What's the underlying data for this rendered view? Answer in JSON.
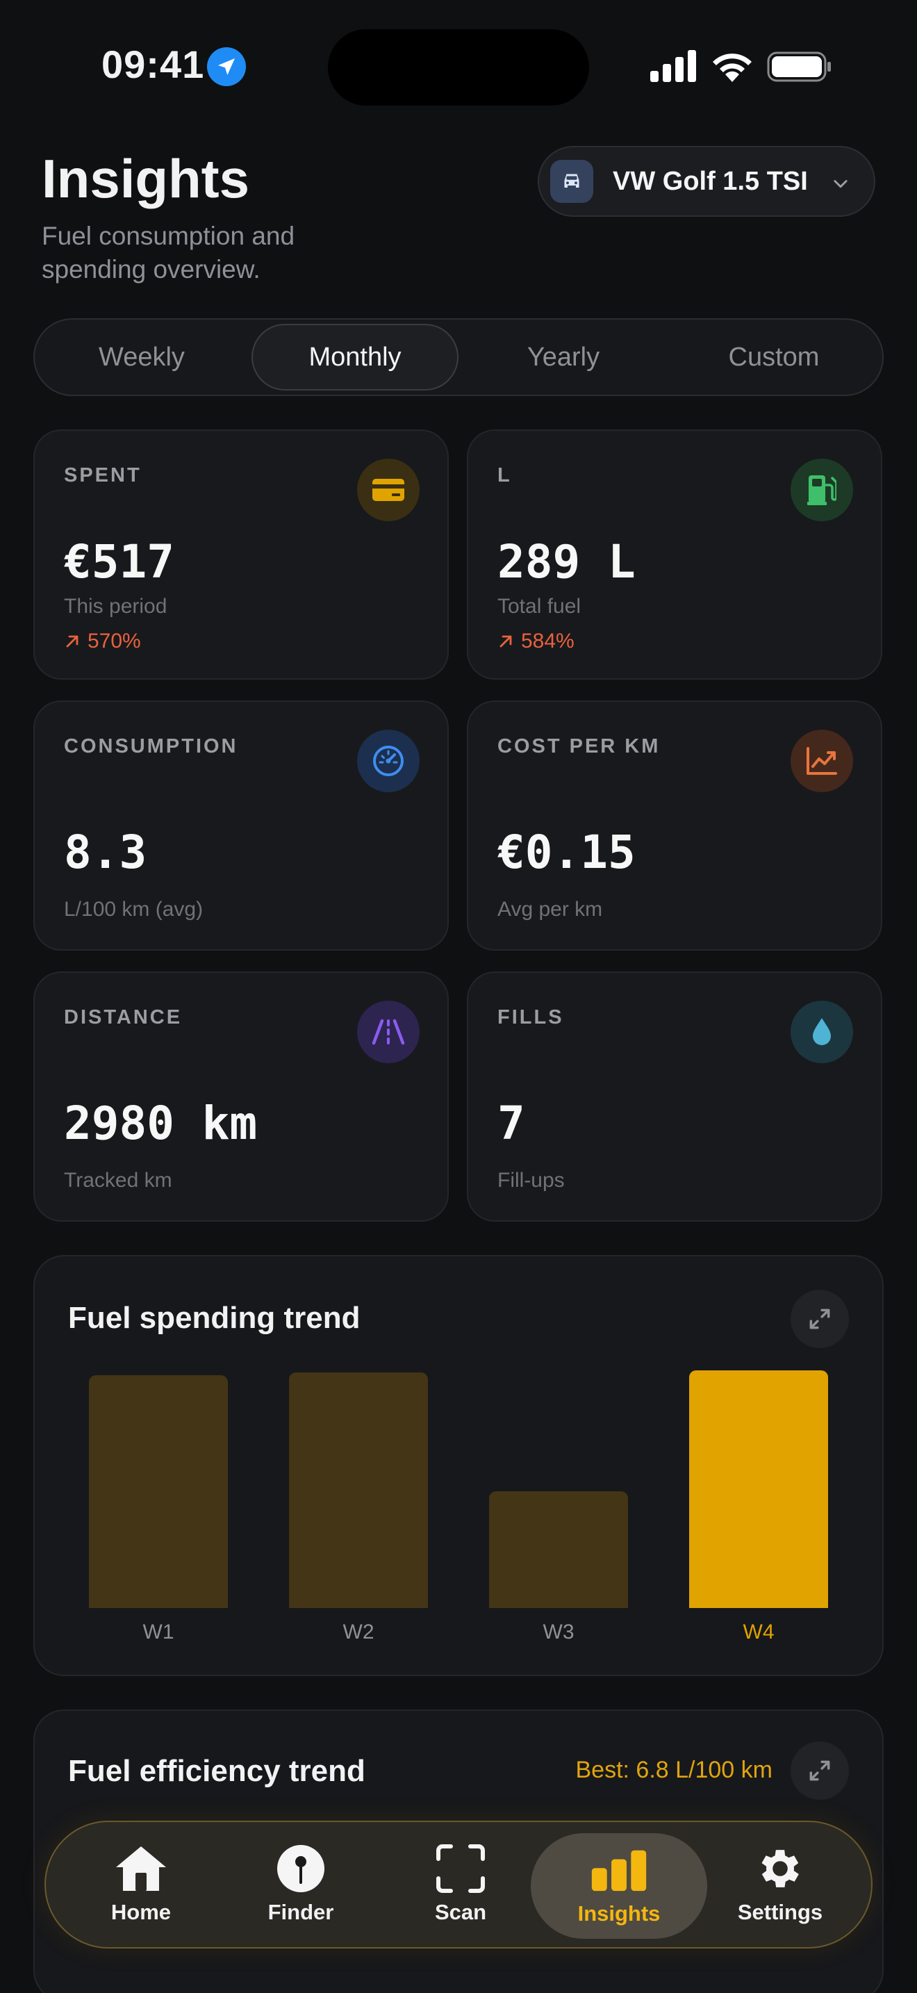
{
  "status_bar": {
    "time": "09:41"
  },
  "header": {
    "title": "Insights",
    "subtitle": "Fuel consumption and spending overview.",
    "vehicle": "VW Golf 1.5 TSI"
  },
  "period_tabs": [
    {
      "label": "Weekly",
      "active": false
    },
    {
      "label": "Monthly",
      "active": true
    },
    {
      "label": "Yearly",
      "active": false
    },
    {
      "label": "Custom",
      "active": false
    }
  ],
  "stats": {
    "spent": {
      "label": "SPENT",
      "value": "€517",
      "sub": "This period",
      "trend": "570%"
    },
    "fuel": {
      "label": "L",
      "value": "289 L",
      "sub": "Total fuel",
      "trend": "584%"
    },
    "consumption": {
      "label": "CONSUMPTION",
      "value": "8.3",
      "sub": "L/100 km (avg)"
    },
    "cost_per_km": {
      "label": "COST PER KM",
      "value": "€0.15",
      "sub": "Avg per km"
    },
    "distance": {
      "label": "DISTANCE",
      "value": "2980 km",
      "sub": "Tracked km"
    },
    "fills": {
      "label": "FILLS",
      "value": "7",
      "sub": "Fill-ups"
    }
  },
  "colors": {
    "accent": "#E0A300",
    "bar_muted": "#433515",
    "trend_up": "#E8623D",
    "spent_icon": "#E0A300",
    "fuel_icon": "#3FBF6A",
    "consumption_icon": "#3E8EF0",
    "cost_icon": "#E8743D",
    "distance_icon": "#8A5CF0",
    "fills_icon": "#4FB3D6"
  },
  "spending_chart": {
    "title": "Fuel spending trend"
  },
  "chart_data": {
    "type": "bar",
    "categories": [
      "W1",
      "W2",
      "W3",
      "W4"
    ],
    "values": [
      0.98,
      0.99,
      0.49,
      1.0
    ],
    "highlight_index": 3,
    "title": "Fuel spending trend",
    "xlabel": "",
    "ylabel": "",
    "grid": false
  },
  "efficiency_chart": {
    "title": "Fuel efficiency trend",
    "best": "Best: 6.8 L/100 km"
  },
  "tab_bar": [
    {
      "label": "Home",
      "icon": "home-icon",
      "active": false
    },
    {
      "label": "Finder",
      "icon": "pin-icon",
      "active": false
    },
    {
      "label": "Scan",
      "icon": "scan-icon",
      "active": false
    },
    {
      "label": "Insights",
      "icon": "bar-chart-icon",
      "active": true
    },
    {
      "label": "Settings",
      "icon": "gear-icon",
      "active": false
    }
  ]
}
